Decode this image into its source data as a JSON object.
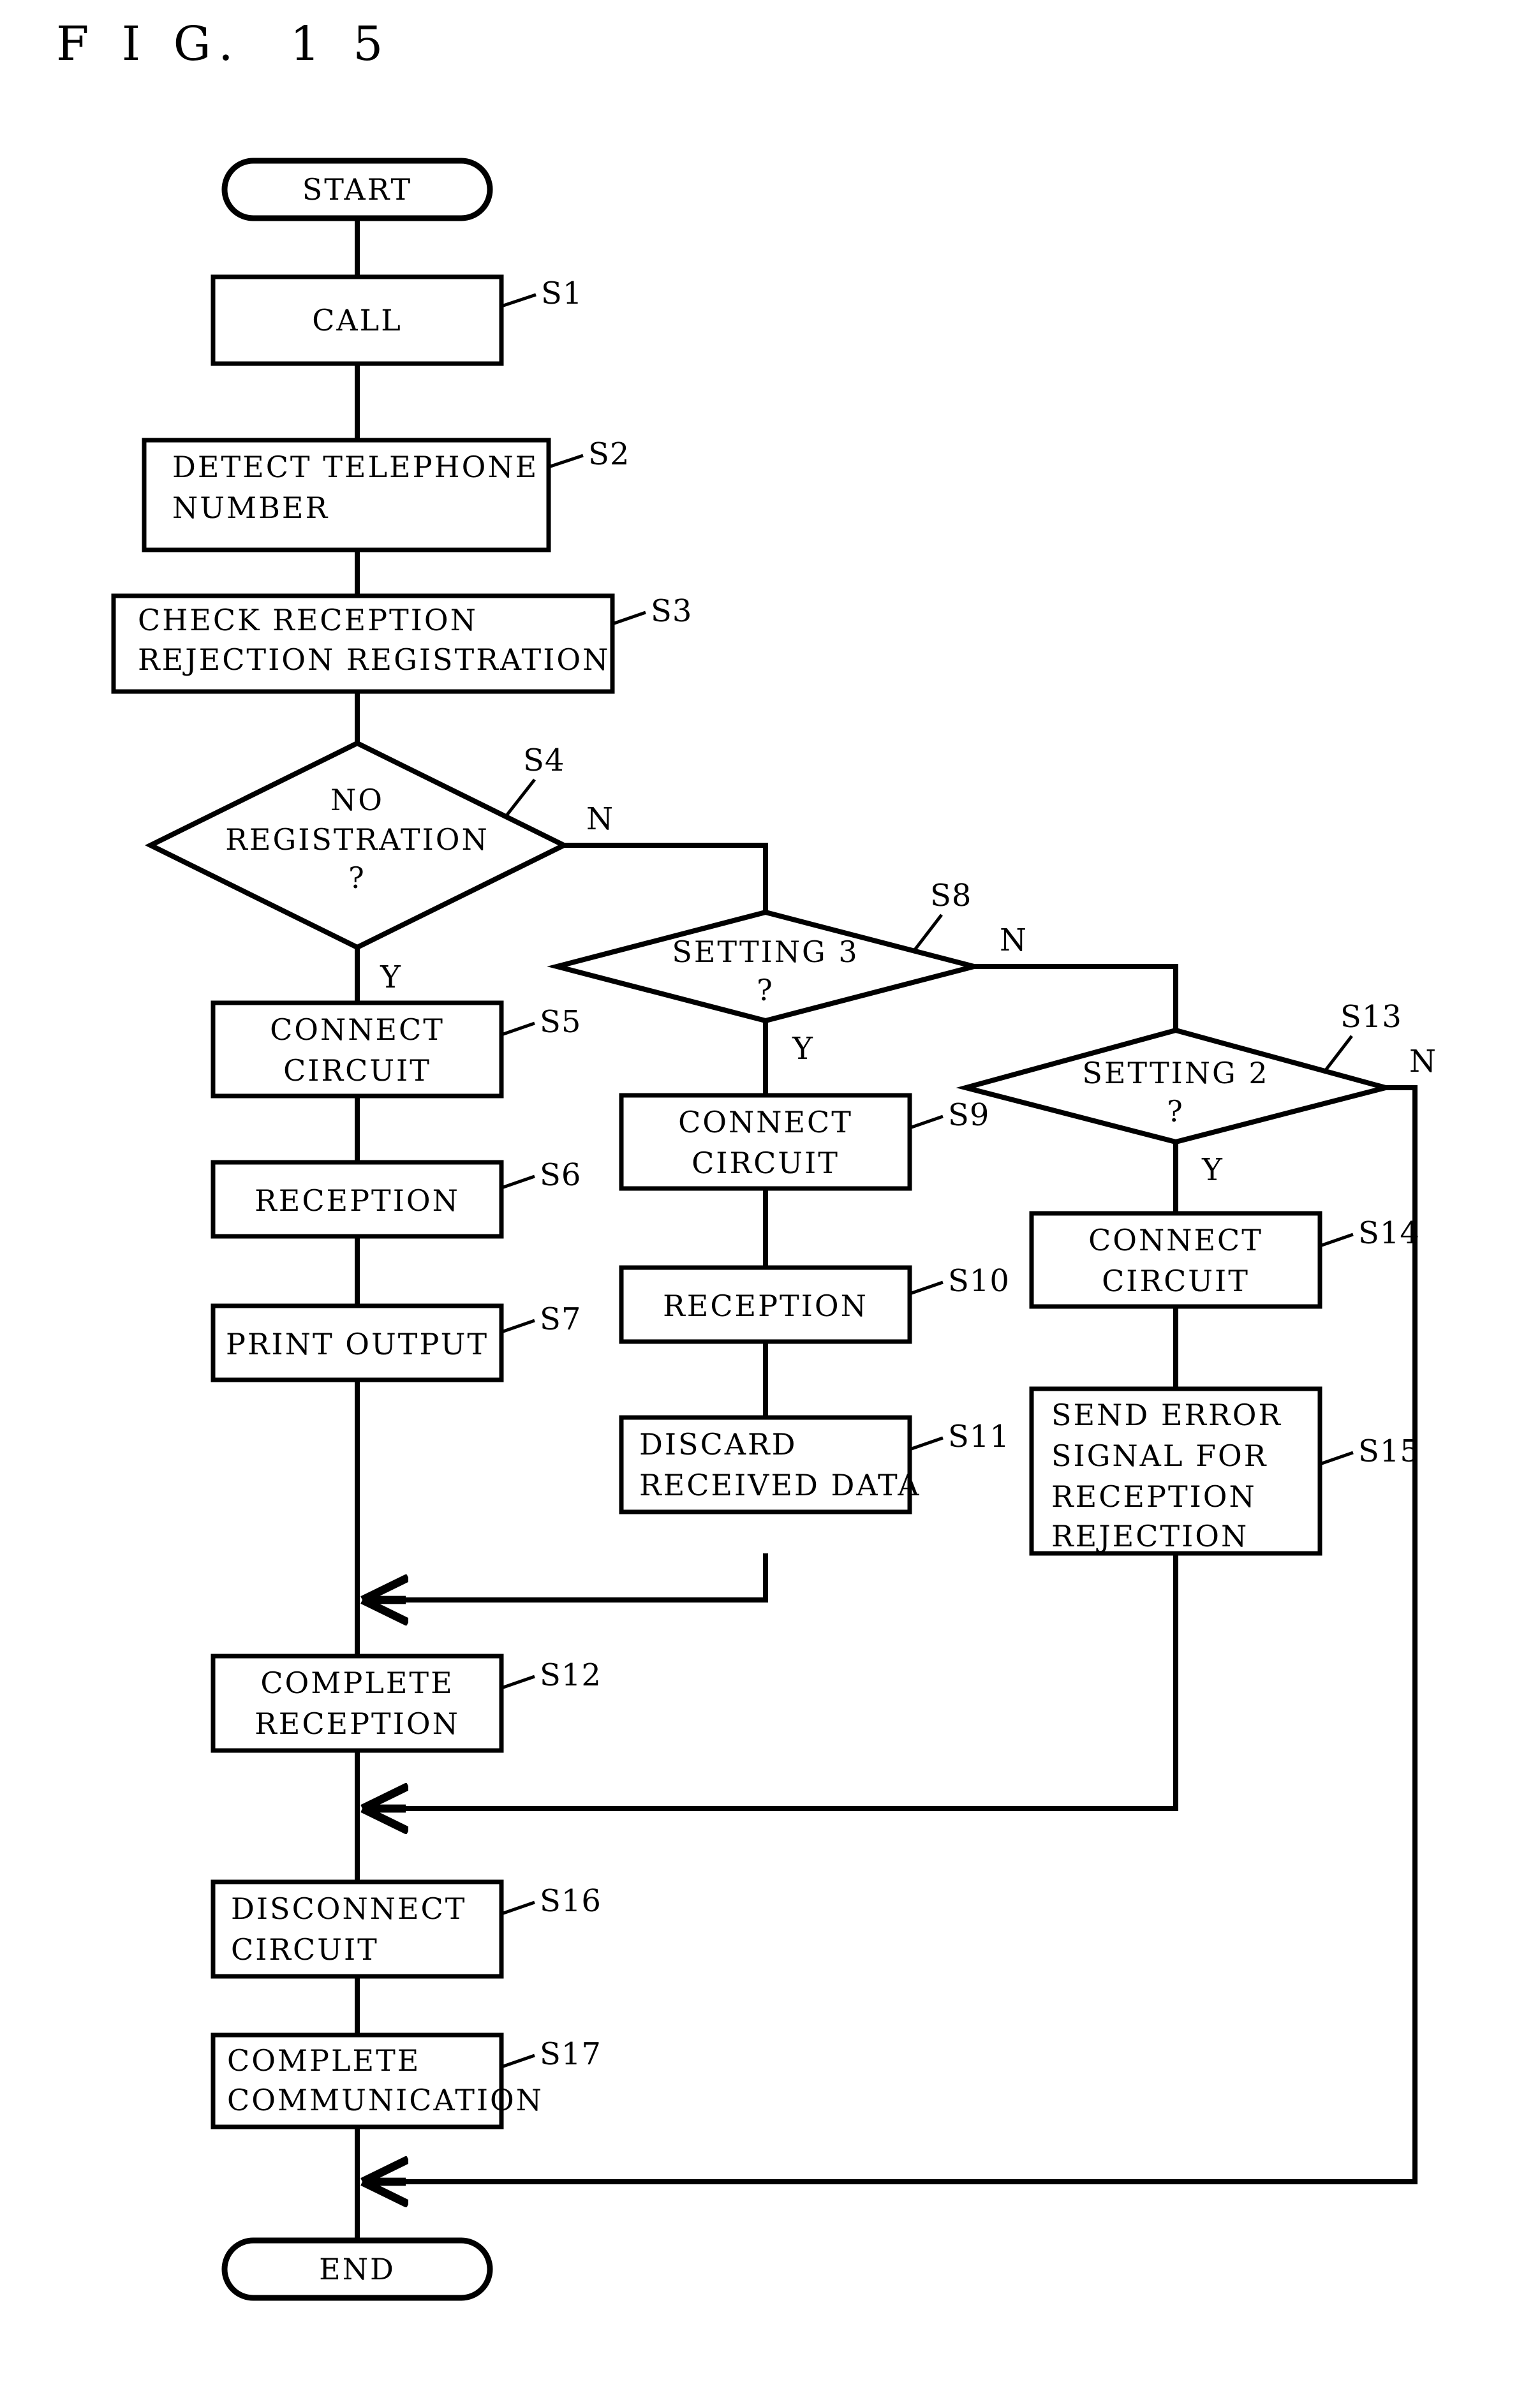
{
  "figure": {
    "title": "F I G.  1 5"
  },
  "chart_data": {
    "type": "diagram",
    "diagram_kind": "flowchart",
    "title": "F I G.  1 5",
    "terminators": [
      {
        "id": "start",
        "label": "START"
      },
      {
        "id": "end",
        "label": "END"
      }
    ],
    "process_nodes": [
      {
        "id": "S1",
        "step": "S1",
        "lines": [
          "CALL"
        ],
        "align": "center"
      },
      {
        "id": "S2",
        "step": "S2",
        "lines": [
          "DETECT TELEPHONE",
          "NUMBER"
        ],
        "align": "left"
      },
      {
        "id": "S3",
        "step": "S3",
        "lines": [
          "CHECK RECEPTION",
          "REJECTION REGISTRATION"
        ],
        "align": "left"
      },
      {
        "id": "S5",
        "step": "S5",
        "lines": [
          "CONNECT",
          "CIRCUIT"
        ],
        "align": "center"
      },
      {
        "id": "S6",
        "step": "S6",
        "lines": [
          "RECEPTION"
        ],
        "align": "center"
      },
      {
        "id": "S7",
        "step": "S7",
        "lines": [
          "PRINT OUTPUT"
        ],
        "align": "center"
      },
      {
        "id": "S9",
        "step": "S9",
        "lines": [
          "CONNECT",
          "CIRCUIT"
        ],
        "align": "center"
      },
      {
        "id": "S10",
        "step": "S10",
        "lines": [
          "RECEPTION"
        ],
        "align": "center"
      },
      {
        "id": "S11",
        "step": "S11",
        "lines": [
          "DISCARD",
          "RECEIVED DATA"
        ],
        "align": "left"
      },
      {
        "id": "S12",
        "step": "S12",
        "lines": [
          "COMPLETE",
          "RECEPTION"
        ],
        "align": "center"
      },
      {
        "id": "S14",
        "step": "S14",
        "lines": [
          "CONNECT",
          "CIRCUIT"
        ],
        "align": "center"
      },
      {
        "id": "S15",
        "step": "S15",
        "lines": [
          "SEND ERROR",
          "SIGNAL FOR",
          "RECEPTION",
          "REJECTION"
        ],
        "align": "left"
      },
      {
        "id": "S16",
        "step": "S16",
        "lines": [
          "DISCONNECT",
          "CIRCUIT"
        ],
        "align": "left"
      },
      {
        "id": "S17",
        "step": "S17",
        "lines": [
          "COMPLETE",
          "COMMUNICATION"
        ],
        "align": "left"
      }
    ],
    "decision_nodes": [
      {
        "id": "S4",
        "step": "S4",
        "lines": [
          "NO",
          "REGISTRATION",
          "?"
        ],
        "yes_label": "Y",
        "no_label": "N"
      },
      {
        "id": "S8",
        "step": "S8",
        "lines": [
          "SETTING 3",
          "?"
        ],
        "yes_label": "Y",
        "no_label": "N"
      },
      {
        "id": "S13",
        "step": "S13",
        "lines": [
          "SETTING 2",
          "?"
        ],
        "yes_label": "Y",
        "no_label": "N"
      }
    ],
    "edges": [
      {
        "from": "start",
        "to": "S1"
      },
      {
        "from": "S1",
        "to": "S2"
      },
      {
        "from": "S2",
        "to": "S3"
      },
      {
        "from": "S3",
        "to": "S4"
      },
      {
        "from": "S4",
        "to": "S5",
        "branch": "Y"
      },
      {
        "from": "S4",
        "to": "S8",
        "branch": "N"
      },
      {
        "from": "S5",
        "to": "S6"
      },
      {
        "from": "S6",
        "to": "S7"
      },
      {
        "from": "S7",
        "to": "S12"
      },
      {
        "from": "S8",
        "to": "S9",
        "branch": "Y"
      },
      {
        "from": "S8",
        "to": "S13",
        "branch": "N"
      },
      {
        "from": "S9",
        "to": "S10"
      },
      {
        "from": "S10",
        "to": "S11"
      },
      {
        "from": "S11",
        "to": "S12"
      },
      {
        "from": "S12",
        "to": "S16"
      },
      {
        "from": "S13",
        "to": "S14",
        "branch": "Y"
      },
      {
        "from": "S13",
        "to": "end",
        "branch": "N"
      },
      {
        "from": "S14",
        "to": "S15"
      },
      {
        "from": "S15",
        "to": "S16"
      },
      {
        "from": "S16",
        "to": "S17"
      },
      {
        "from": "S17",
        "to": "end"
      }
    ],
    "colors": {
      "line": "#000000",
      "fill": "#ffffff",
      "background": "#ffffff"
    }
  }
}
